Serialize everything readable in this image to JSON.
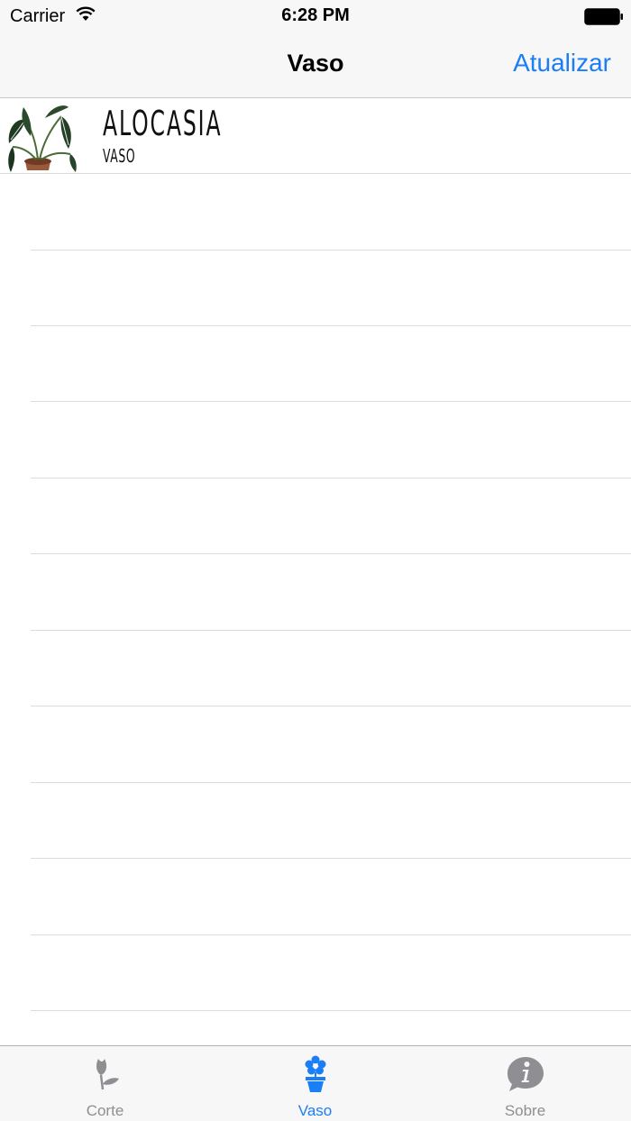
{
  "status_bar": {
    "carrier": "Carrier",
    "time": "6:28 PM"
  },
  "nav": {
    "title": "Vaso",
    "action_label": "Atualizar"
  },
  "list": {
    "items": [
      {
        "title": "ALOCASIA",
        "subtitle": "VASO"
      }
    ]
  },
  "tab_bar": {
    "tabs": [
      {
        "label": "Corte",
        "icon": "flower-bud-icon",
        "selected": false
      },
      {
        "label": "Vaso",
        "icon": "potted-flower-icon",
        "selected": true
      },
      {
        "label": "Sobre",
        "icon": "info-bubble-icon",
        "selected": false
      }
    ]
  },
  "colors": {
    "accent": "#1a7ef6",
    "inactive": "#8e8e93",
    "separator": "#dcdcdc"
  }
}
